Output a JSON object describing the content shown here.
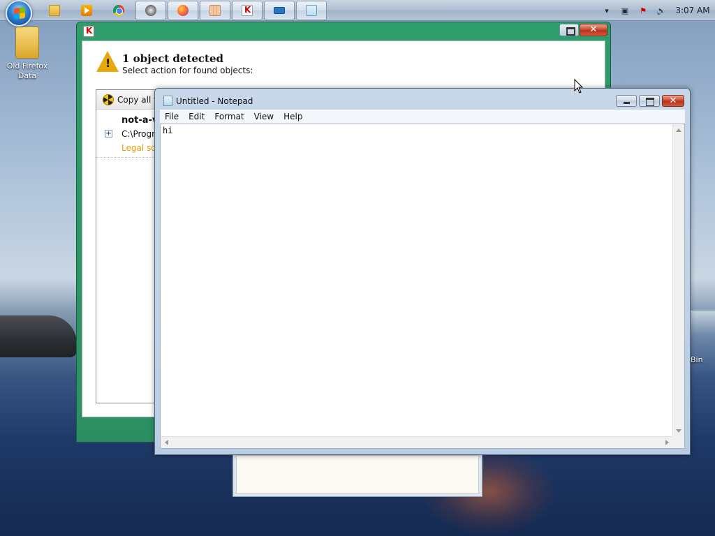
{
  "desktop": {
    "icons": [
      {
        "label": "Old Firefox Data",
        "icon": "folder-icon"
      }
    ],
    "partial_label": "Bin"
  },
  "taskbar": {
    "start_icon": "windows-start-orb",
    "items": [
      {
        "icon": "folder-icon",
        "active": false
      },
      {
        "icon": "media-player-icon",
        "active": false
      },
      {
        "icon": "chrome-icon",
        "active": false
      },
      {
        "icon": "steam-icon",
        "active": true
      },
      {
        "icon": "firefox-icon",
        "active": true
      },
      {
        "icon": "grid-app-icon",
        "active": true
      },
      {
        "icon": "kaspersky-icon",
        "active": true
      },
      {
        "icon": "keyboard-icon",
        "active": true
      },
      {
        "icon": "notepad-icon",
        "active": true
      }
    ],
    "tray": {
      "icons": [
        "show-hidden-icon",
        "network-icon",
        "action-center-flag-icon",
        "volume-icon"
      ],
      "clock": "3:07 AM"
    }
  },
  "kaspersky": {
    "title": "1 object detected",
    "subtitle": "Select action for found objects:",
    "toolbar_label": "Copy all to",
    "detection": {
      "name": "not-a-vi",
      "path": "C:\\Progra",
      "type": "Legal sof"
    },
    "colors": {
      "frame": "#2c8f63",
      "warning": "#e7a80c",
      "type_text": "#e8a000"
    }
  },
  "notepad": {
    "title": "Untitled - Notepad",
    "menu": [
      "File",
      "Edit",
      "Format",
      "View",
      "Help"
    ],
    "content": "hi"
  }
}
